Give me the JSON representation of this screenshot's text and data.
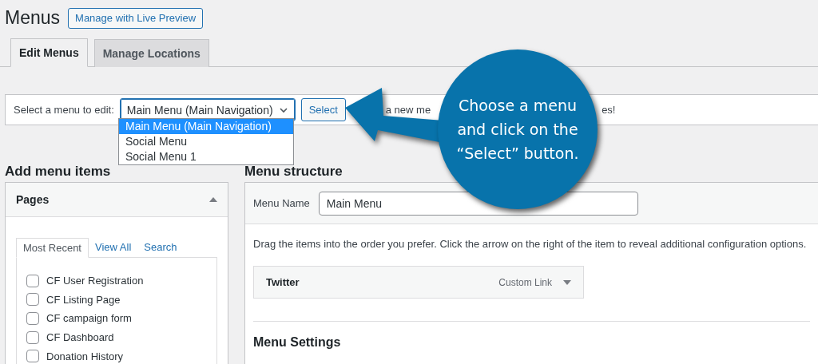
{
  "page": {
    "title": "Menus",
    "action_button": "Manage with Live Preview"
  },
  "tabs": [
    {
      "label": "Edit Menus",
      "selected": true
    },
    {
      "label": "Manage Locations",
      "selected": false
    }
  ],
  "menu_selector": {
    "label": "Select a menu to edit:",
    "value": "Main Menu (Main Navigation)",
    "button": "Select",
    "expanded": true,
    "options": [
      {
        "label": "Main Menu (Main Navigation)",
        "selected": true
      },
      {
        "label": "Social Menu",
        "selected": false
      },
      {
        "label": "Social Menu 1",
        "selected": false
      }
    ],
    "notice_fragments": [
      "a new me",
      "es!"
    ]
  },
  "add_menu_items": {
    "heading": "Add menu items",
    "panel": {
      "title": "Pages",
      "expanded": true,
      "tabs": [
        {
          "label": "Most Recent",
          "selected": true
        },
        {
          "label": "View All",
          "selected": false
        },
        {
          "label": "Search",
          "selected": false
        }
      ],
      "items": [
        {
          "label": "CF User Registration",
          "checked": false
        },
        {
          "label": "CF Listing Page",
          "checked": false
        },
        {
          "label": "CF campaign form",
          "checked": false
        },
        {
          "label": "CF Dashboard",
          "checked": false
        },
        {
          "label": "Donation History",
          "checked": false
        }
      ]
    }
  },
  "menu_structure": {
    "heading": "Menu structure",
    "name_label": "Menu Name",
    "name_value": "Main Menu",
    "instructions": "Drag the items into the order you prefer. Click the arrow on the right of the item to reveal additional configuration options.",
    "items": [
      {
        "title": "Twitter",
        "type": "Custom Link"
      }
    ],
    "settings_heading": "Menu Settings"
  },
  "callout": {
    "text": "Choose a menu and click on the “Select” button."
  }
}
